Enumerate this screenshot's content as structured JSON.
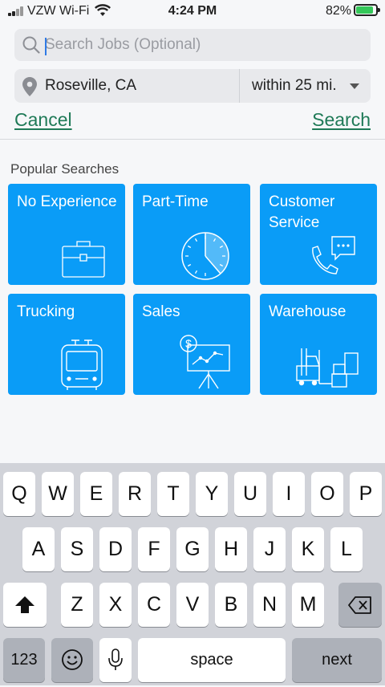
{
  "status_bar": {
    "carrier": "VZW Wi-Fi",
    "time": "4:24 PM",
    "battery": "82%"
  },
  "search": {
    "placeholder": "Search Jobs (Optional)",
    "value": ""
  },
  "location": {
    "city": "Roseville, CA",
    "radius": "within 25 mi."
  },
  "actions": {
    "cancel": "Cancel",
    "search": "Search"
  },
  "popular": {
    "heading": "Popular Searches",
    "tiles": [
      {
        "label": "No Experience",
        "icon": "briefcase-icon"
      },
      {
        "label": "Part-Time",
        "icon": "clock-icon"
      },
      {
        "label": "Customer Service",
        "icon": "phone-chat-icon"
      },
      {
        "label": "Trucking",
        "icon": "truck-icon"
      },
      {
        "label": "Sales",
        "icon": "chart-presentation-icon"
      },
      {
        "label": "Warehouse",
        "icon": "forklift-icon"
      }
    ]
  },
  "keyboard": {
    "row1": [
      "Q",
      "W",
      "E",
      "R",
      "T",
      "Y",
      "U",
      "I",
      "O",
      "P"
    ],
    "row2": [
      "A",
      "S",
      "D",
      "F",
      "G",
      "H",
      "J",
      "K",
      "L"
    ],
    "row3": [
      "Z",
      "X",
      "C",
      "V",
      "B",
      "N",
      "M"
    ],
    "numbers": "123",
    "space": "space",
    "next": "next"
  },
  "colors": {
    "tile": "#0a9cf7",
    "link": "#1f7a57",
    "background": "#f6f7f9"
  }
}
